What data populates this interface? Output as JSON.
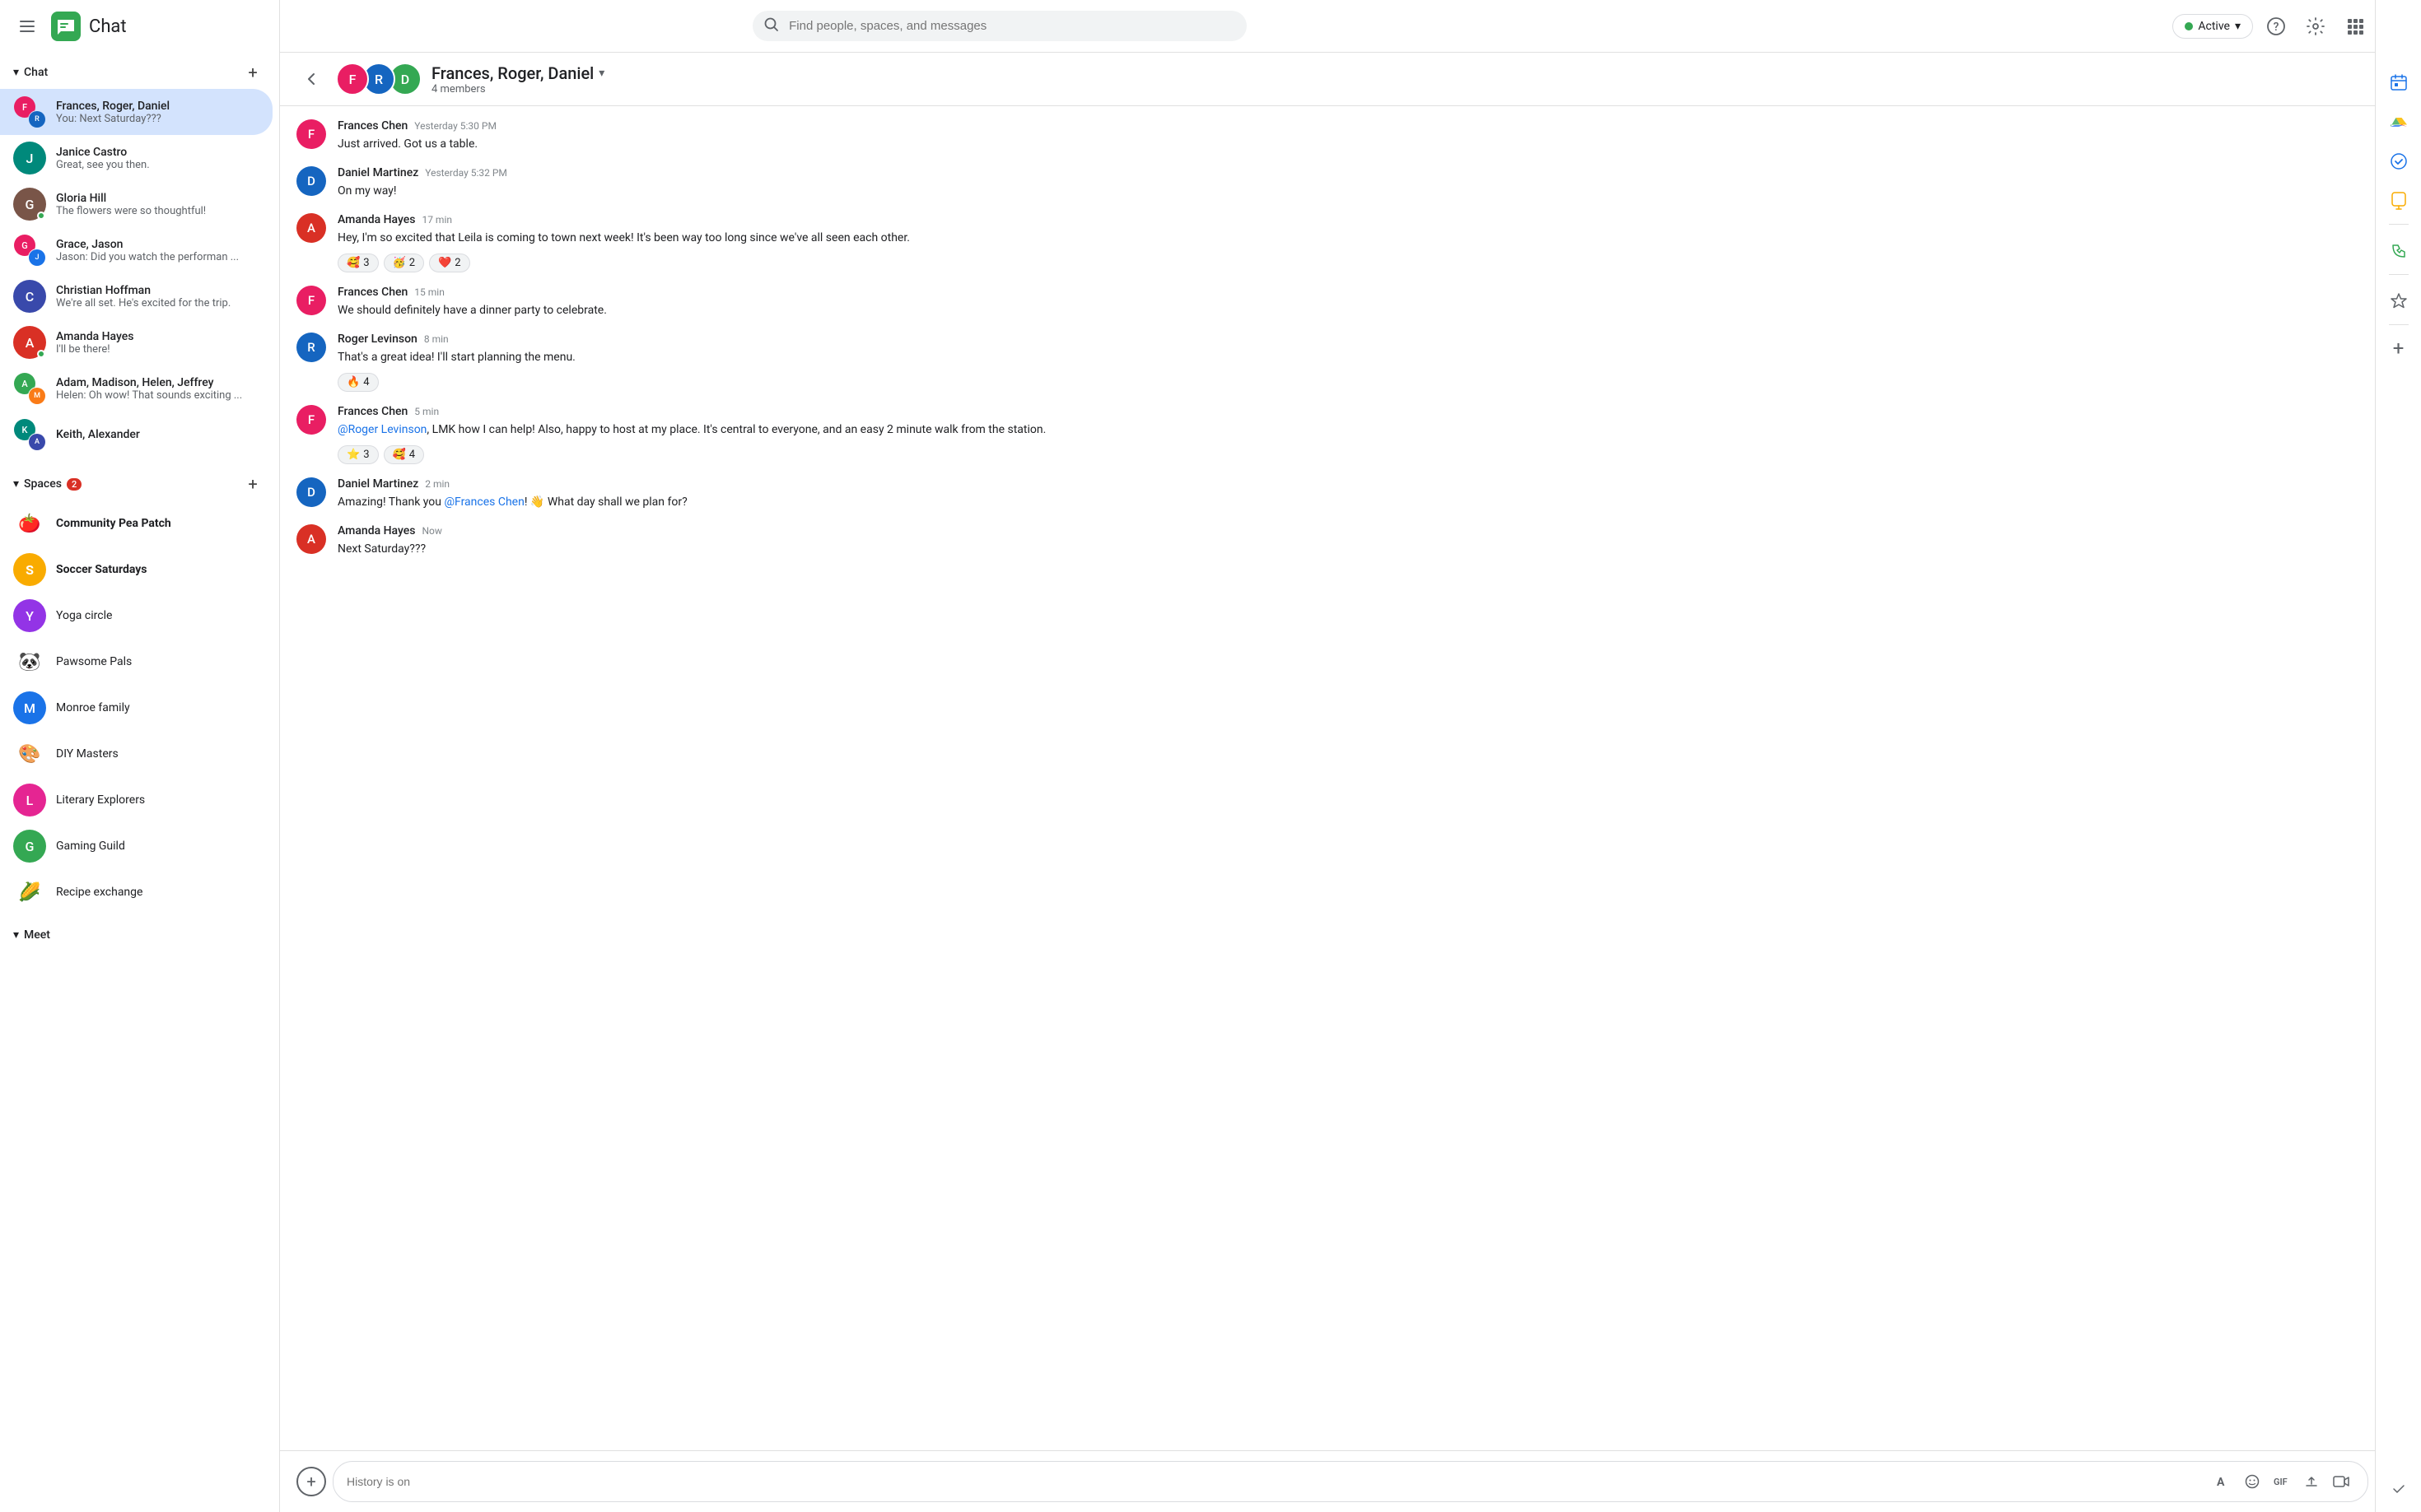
{
  "app": {
    "title": "Chat",
    "logo_emoji": "💬"
  },
  "topbar": {
    "search_placeholder": "Find people, spaces, and messages",
    "active_label": "Active",
    "active_chevron": "▾"
  },
  "sidebar": {
    "chat_section_label": "Chat",
    "spaces_section_label": "Spaces",
    "spaces_badge": "2",
    "meet_section_label": "Meet",
    "chat_items": [
      {
        "id": "frances-roger-daniel",
        "name": "Frances, Roger, Daniel",
        "preview": "You: Next Saturday???",
        "active": true,
        "type": "group"
      },
      {
        "id": "janice-castro",
        "name": "Janice Castro",
        "preview": "Great, see you then.",
        "active": false,
        "type": "single"
      },
      {
        "id": "gloria-hill",
        "name": "Gloria Hill",
        "preview": "The flowers were so thoughtful!",
        "active": false,
        "type": "single",
        "online": true
      },
      {
        "id": "grace-jason",
        "name": "Grace, Jason",
        "preview": "Jason: Did you watch the performan ...",
        "active": false,
        "type": "group"
      },
      {
        "id": "christian-hoffman",
        "name": "Christian Hoffman",
        "preview": "We're all set.  He's excited for the trip.",
        "active": false,
        "type": "single"
      },
      {
        "id": "amanda-hayes",
        "name": "Amanda Hayes",
        "preview": "I'll be there!",
        "active": false,
        "type": "single",
        "online": true
      },
      {
        "id": "adam-madison-helen-jeffrey",
        "name": "Adam, Madison, Helen, Jeffrey",
        "preview": "Helen: Oh wow! That sounds exciting ...",
        "active": false,
        "type": "group"
      },
      {
        "id": "keith-alexander",
        "name": "Keith, Alexander",
        "preview": "",
        "active": false,
        "type": "group"
      }
    ],
    "spaces": [
      {
        "id": "community-pea-patch",
        "name": "Community Pea Patch",
        "icon": "🍅",
        "bold": true
      },
      {
        "id": "soccer-saturdays",
        "name": "Soccer Saturdays",
        "icon": "S",
        "bold": true,
        "color": "#f9ab00"
      },
      {
        "id": "yoga-circle",
        "name": "Yoga circle",
        "icon": "Y",
        "bold": false,
        "color": "#9334e6"
      },
      {
        "id": "pawsome-pals",
        "name": "Pawsome Pals",
        "icon": "🐼",
        "bold": false
      },
      {
        "id": "monroe-family",
        "name": "Monroe family",
        "icon": "M",
        "bold": false,
        "color": "#1a73e8"
      },
      {
        "id": "diy-masters",
        "name": "DIY Masters",
        "icon": "🎨",
        "bold": false
      },
      {
        "id": "literary-explorers",
        "name": "Literary Explorers",
        "icon": "L",
        "bold": false,
        "color": "#e52592"
      },
      {
        "id": "gaming-guild",
        "name": "Gaming Guild",
        "icon": "G",
        "bold": false,
        "color": "#34a853"
      },
      {
        "id": "recipe-exchange",
        "name": "Recipe exchange",
        "icon": "🌽",
        "bold": false
      }
    ]
  },
  "chat_header": {
    "title": "Frances, Roger, Daniel",
    "dropdown_arrow": "▾",
    "members": "4 members"
  },
  "messages": [
    {
      "id": "msg1",
      "sender": "Frances Chen",
      "time": "Yesterday 5:30 PM",
      "text": "Just arrived.  Got us a table.",
      "reactions": [],
      "has_link": false
    },
    {
      "id": "msg2",
      "sender": "Daniel Martinez",
      "time": "Yesterday 5:32 PM",
      "text": "On my way!",
      "reactions": [],
      "has_link": false
    },
    {
      "id": "msg3",
      "sender": "Amanda Hayes",
      "time": "17 min",
      "text": "Hey, I'm so excited that Leila is coming to town next week! It's been way too long since we've all seen each other.",
      "reactions": [
        {
          "emoji": "🥰",
          "count": 3
        },
        {
          "emoji": "🥳",
          "count": 2
        },
        {
          "emoji": "❤️",
          "count": 2
        }
      ],
      "has_link": false
    },
    {
      "id": "msg4",
      "sender": "Frances Chen",
      "time": "15 min",
      "text": "We should definitely have a dinner party to celebrate.",
      "reactions": [],
      "has_link": false
    },
    {
      "id": "msg5",
      "sender": "Roger Levinson",
      "time": "8 min",
      "text": "That's a great idea! I'll start planning the menu.",
      "reactions": [
        {
          "emoji": "🔥",
          "count": 4
        }
      ],
      "has_link": false
    },
    {
      "id": "msg6",
      "sender": "Frances Chen",
      "time": "5 min",
      "text_parts": [
        "",
        "@Roger Levinson",
        ", LMK how I can help!  Also, happy to host at my place. It's central to everyone, and an easy 2 minute walk from the station."
      ],
      "reactions": [
        {
          "emoji": "⭐",
          "count": 3
        },
        {
          "emoji": "🥰",
          "count": 4
        }
      ],
      "has_link": true,
      "mention": "@Roger Levinson"
    },
    {
      "id": "msg7",
      "sender": "Daniel Martinez",
      "time": "2 min",
      "text_parts": [
        "Amazing! Thank you ",
        "@Frances Chen",
        "! 👋 What day shall we plan for?"
      ],
      "reactions": [],
      "has_link": true,
      "mention": "@Frances Chen"
    },
    {
      "id": "msg8",
      "sender": "Amanda Hayes",
      "time": "Now",
      "text": "Next Saturday???",
      "reactions": [],
      "has_link": false
    }
  ],
  "input": {
    "placeholder": "History is on"
  },
  "right_sidebar": {
    "icons": [
      "calendar",
      "drive",
      "tasks",
      "keep",
      "phone",
      "star"
    ]
  }
}
